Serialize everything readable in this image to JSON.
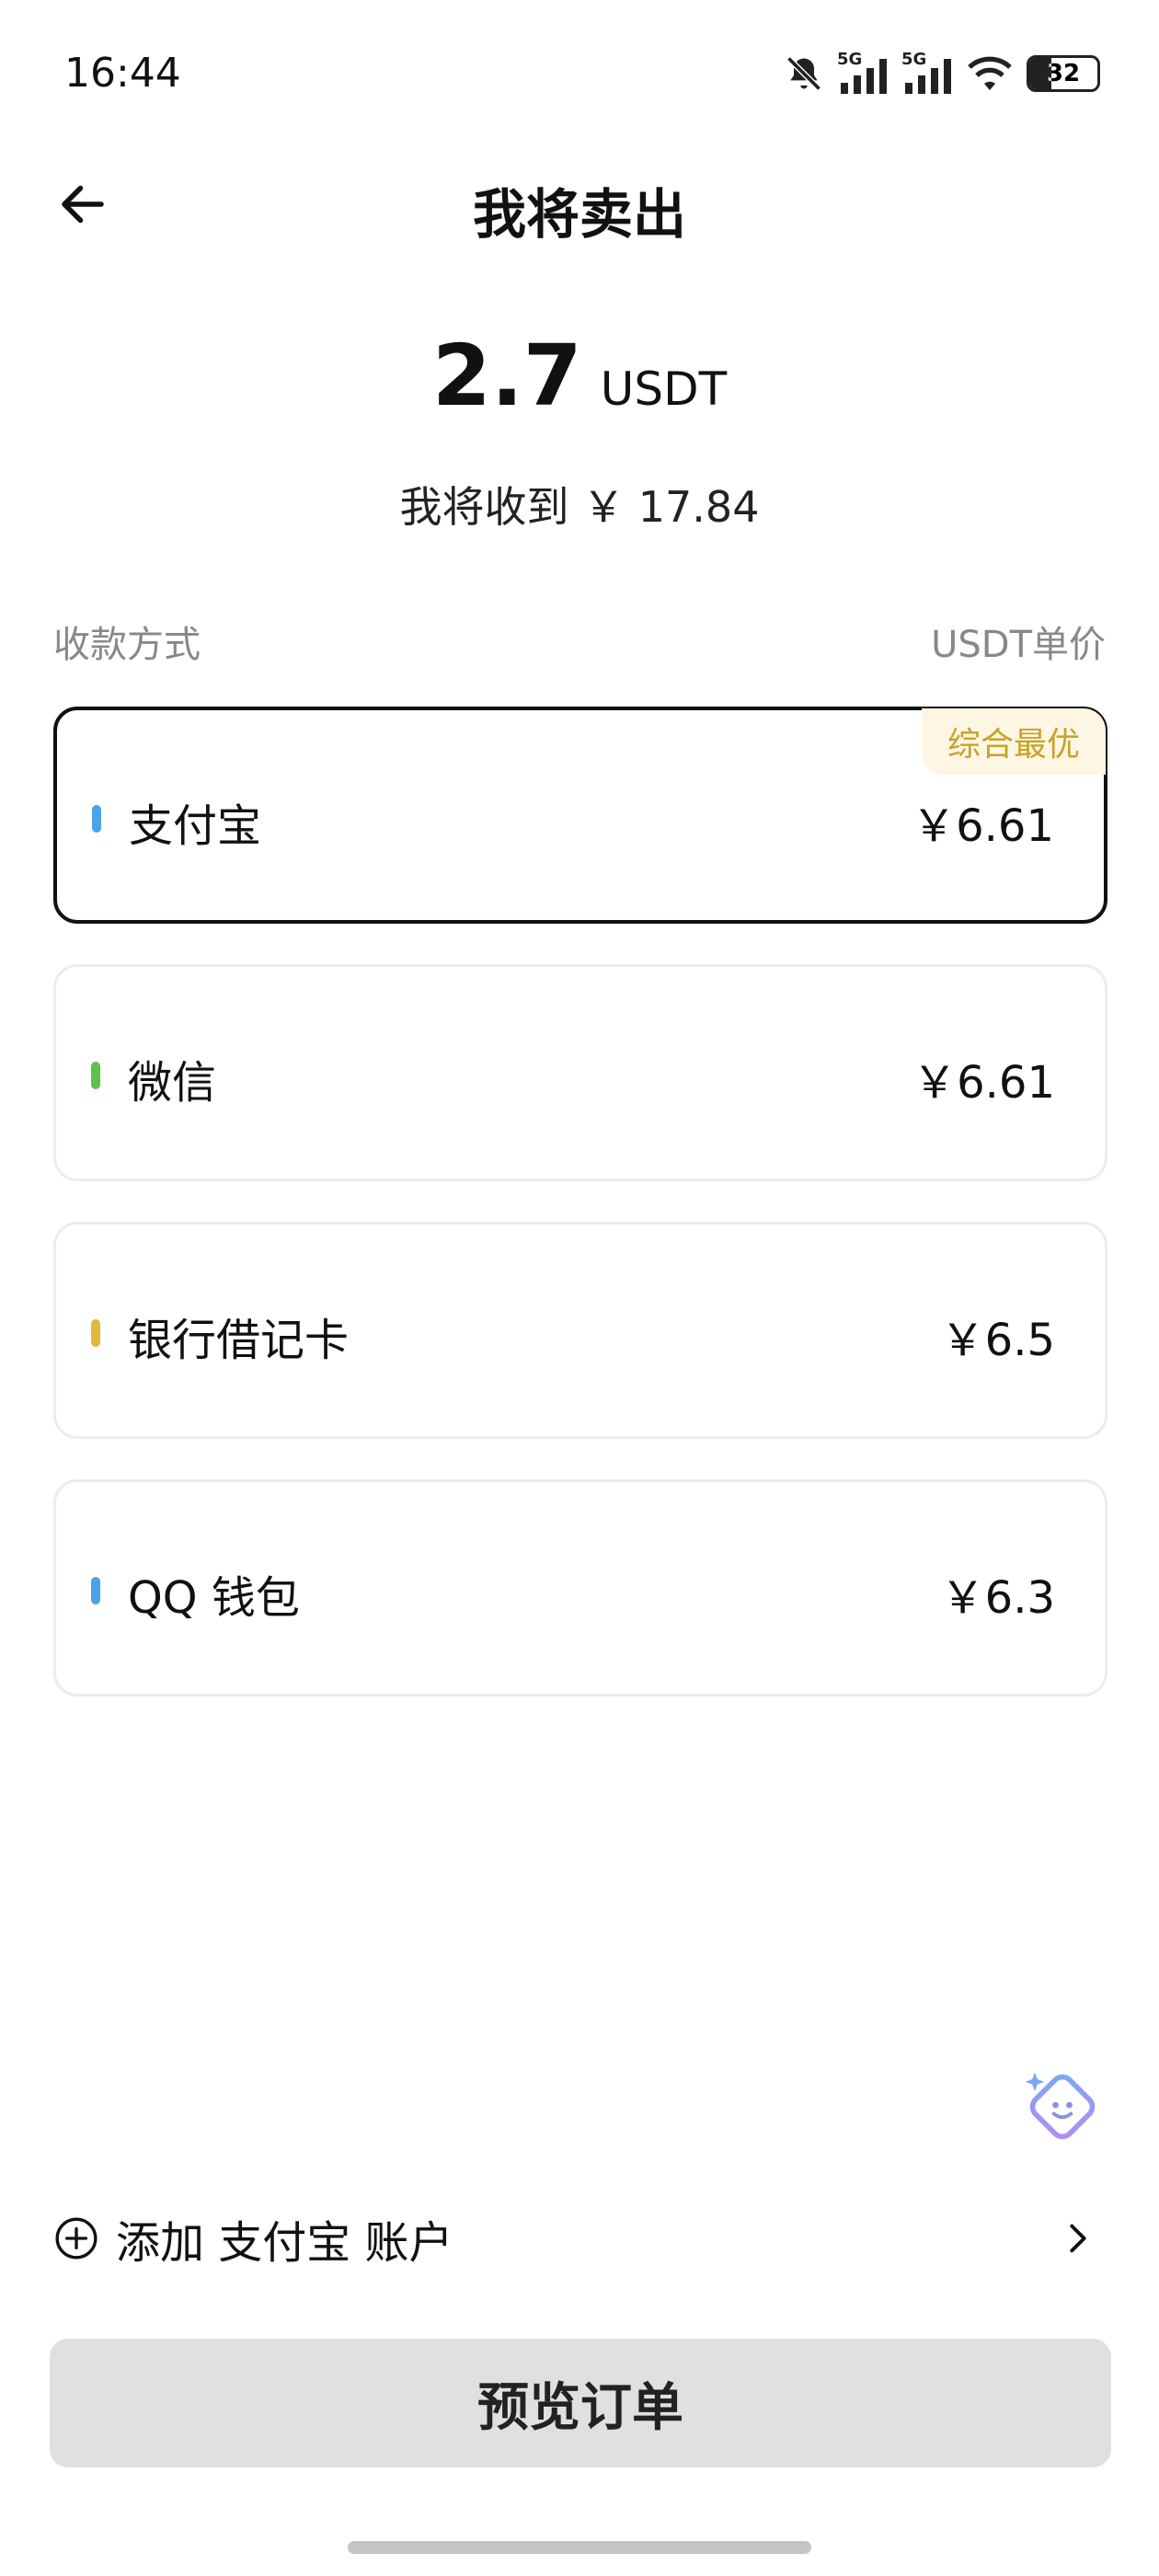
{
  "status_bar": {
    "time": "16:44",
    "network_1": "5G",
    "network_2": "5G",
    "battery": "32",
    "icons": [
      "bell-mute-icon",
      "signal-icon",
      "signal-icon",
      "wifi-icon",
      "battery-icon"
    ]
  },
  "header": {
    "title": "我将卖出",
    "back_icon": "arrow-left-icon"
  },
  "amount": {
    "value": "2.7",
    "unit": "USDT"
  },
  "receive_text": "我将收到 ￥ 17.84",
  "labels": {
    "method": "收款方式",
    "price": "USDT单价"
  },
  "methods": [
    {
      "name": "支付宝",
      "price": "￥6.61",
      "badge": "综合最优",
      "color": "#4aa3e8",
      "selected": true
    },
    {
      "name": "微信",
      "price": "￥6.61",
      "color": "#5cc24b",
      "selected": false
    },
    {
      "name": "银行借记卡",
      "price": "￥6.5",
      "color": "#e0b93b",
      "selected": false
    },
    {
      "name": "QQ 钱包",
      "price": "￥6.3",
      "color": "#4aa3e8",
      "selected": false
    }
  ],
  "add_account": {
    "label": "添加 支付宝 账户",
    "icon": "plus-circle-icon",
    "chevron": "chevron-right-icon"
  },
  "assistant_icon": "assistant-face-icon",
  "preview_button": {
    "label": "预览订单"
  },
  "colors": {
    "selected_border": "#111111",
    "badge_bg": "#fdf6e3",
    "badge_text": "#c9a227",
    "button_bg": "#e0e0e0"
  }
}
